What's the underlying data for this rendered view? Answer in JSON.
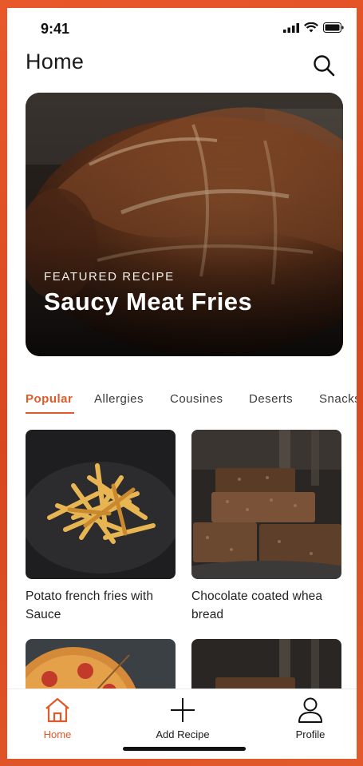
{
  "status_bar": {
    "time": "9:41"
  },
  "header": {
    "title": "Home"
  },
  "featured": {
    "label": "FEATURED RECIPE",
    "title": "Saucy Meat Fries"
  },
  "tabs": [
    {
      "label": "Popular"
    },
    {
      "label": "Allergies"
    },
    {
      "label": "Cousines"
    },
    {
      "label": "Deserts"
    },
    {
      "label": "Snacks"
    }
  ],
  "recipes": [
    {
      "name": "Potato french fries with Sauce"
    },
    {
      "name": "Chocolate coated whea bread"
    },
    {
      "name": ""
    },
    {
      "name": ""
    }
  ],
  "bottom_nav": {
    "home": "Home",
    "add": "Add Recipe",
    "profile": "Profile"
  },
  "colors": {
    "accent": "#e05a2a",
    "background": "#e8592a",
    "text": "#1a1a1a"
  }
}
